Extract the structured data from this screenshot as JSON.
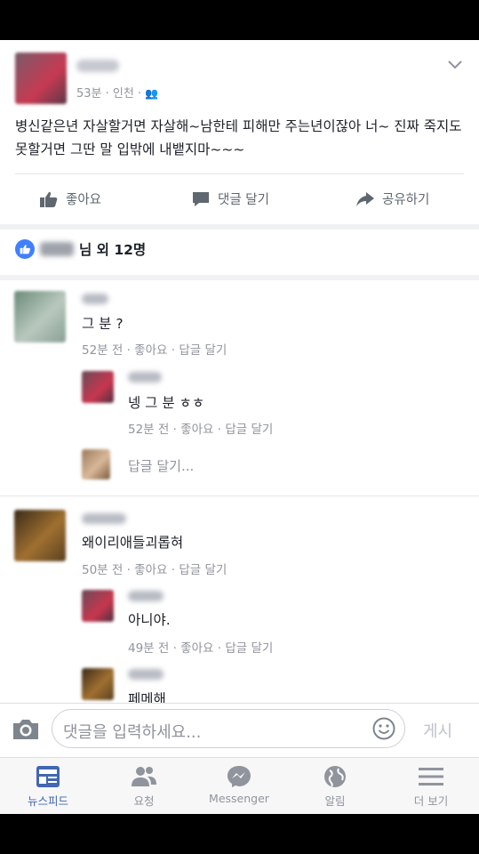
{
  "post": {
    "meta": "53분 · 인천 · ",
    "text": "병신같은년 자살할거면 자살해~남한테 피해만 주는년이잖아 너~ 진짜 죽지도 못할거면 그딴 말 입밖에 내뱉지마~~~"
  },
  "actions": {
    "like": "좋아요",
    "comment": "댓글 달기",
    "share": "공유하기"
  },
  "likes": {
    "summary": "님 외 12명"
  },
  "comments": [
    {
      "text": "그 분 ?",
      "meta": "52분 전 · 좋아요 · 답글 달기"
    },
    {
      "text": "넹 그 분 ㅎㅎ",
      "meta": "52분 전 · 좋아요 · 답글 달기"
    },
    {
      "text": "답글 달기..."
    },
    {
      "text": "왜이리애들괴롭혀",
      "meta": "50분 전 · 좋아요 · 답글 달기"
    },
    {
      "text": "아니야.",
      "meta": "49분 전 · 좋아요 · 답글 달기"
    },
    {
      "text": "페메해"
    }
  ],
  "composer": {
    "placeholder": "댓글을 입력하세요...",
    "post": "게시"
  },
  "tabs": [
    "뉴스피드",
    "요청",
    "Messenger",
    "알림",
    "더 보기"
  ],
  "colors": {
    "accent": "#4267b2",
    "like_blue": "#4080ff",
    "muted": "#90949c"
  }
}
